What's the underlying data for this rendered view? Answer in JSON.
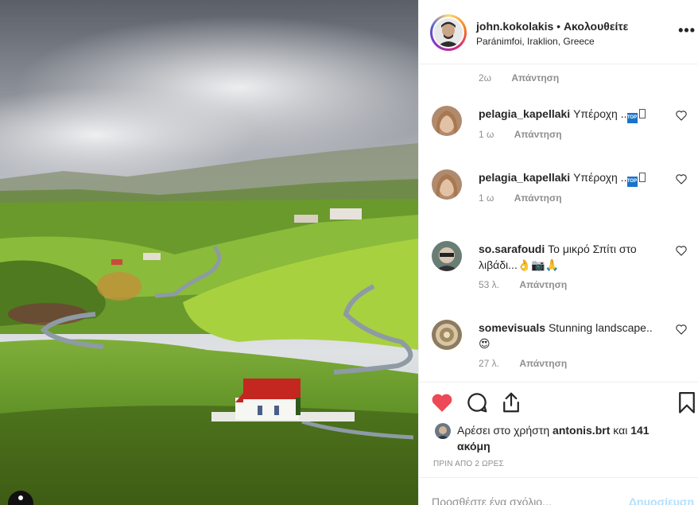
{
  "header": {
    "username": "john.kokolakis",
    "separator": "•",
    "follow_status": "Ακολουθείτε",
    "location": "Paránimfoi, Iraklion, Greece",
    "more_icon": "more-horizontal-icon",
    "more_label": "•••"
  },
  "comments": {
    "first_meta": {
      "time": "2ω",
      "reply": "Απάντηση"
    },
    "items": [
      {
        "user": "pelagia_kapellaki",
        "text": "Υπέροχη ..",
        "emoji": "TOP",
        "time": "1 ω",
        "reply": "Απάντηση"
      },
      {
        "user": "pelagia_kapellaki",
        "text": "Υπέροχη ..",
        "emoji": "TOP",
        "time": "1 ω",
        "reply": "Απάντηση"
      },
      {
        "user": "so.sarafoudi",
        "text": "Το μικρό Σπίτι στο λιβάδι...",
        "emoji_tail": "👌📷🙏",
        "time": "53 λ.",
        "reply": "Απάντηση"
      },
      {
        "user": "somevisuals",
        "text": "Stunning landscape..",
        "emoji_tail": "😍",
        "time": "27 λ.",
        "reply": "Απάντηση"
      }
    ]
  },
  "actions": {
    "like_icon": "heart-filled-icon",
    "comment_icon": "comment-icon",
    "share_icon": "share-icon",
    "save_icon": "bookmark-icon",
    "like_color": "#ed4956",
    "liked_by_prefix": "Αρέσει στο χρήστη",
    "liked_by_user": "antonis.brt",
    "liked_by_suffix": "και",
    "liked_by_more": "141 ακόμη",
    "time_ago": "ΠΡΙΝ ΑΠΟ 2 ΩΡΕΣ"
  },
  "add_comment": {
    "placeholder": "Προσθέστε ένα σχόλιο...",
    "post_label": "Δημοσίευση"
  }
}
